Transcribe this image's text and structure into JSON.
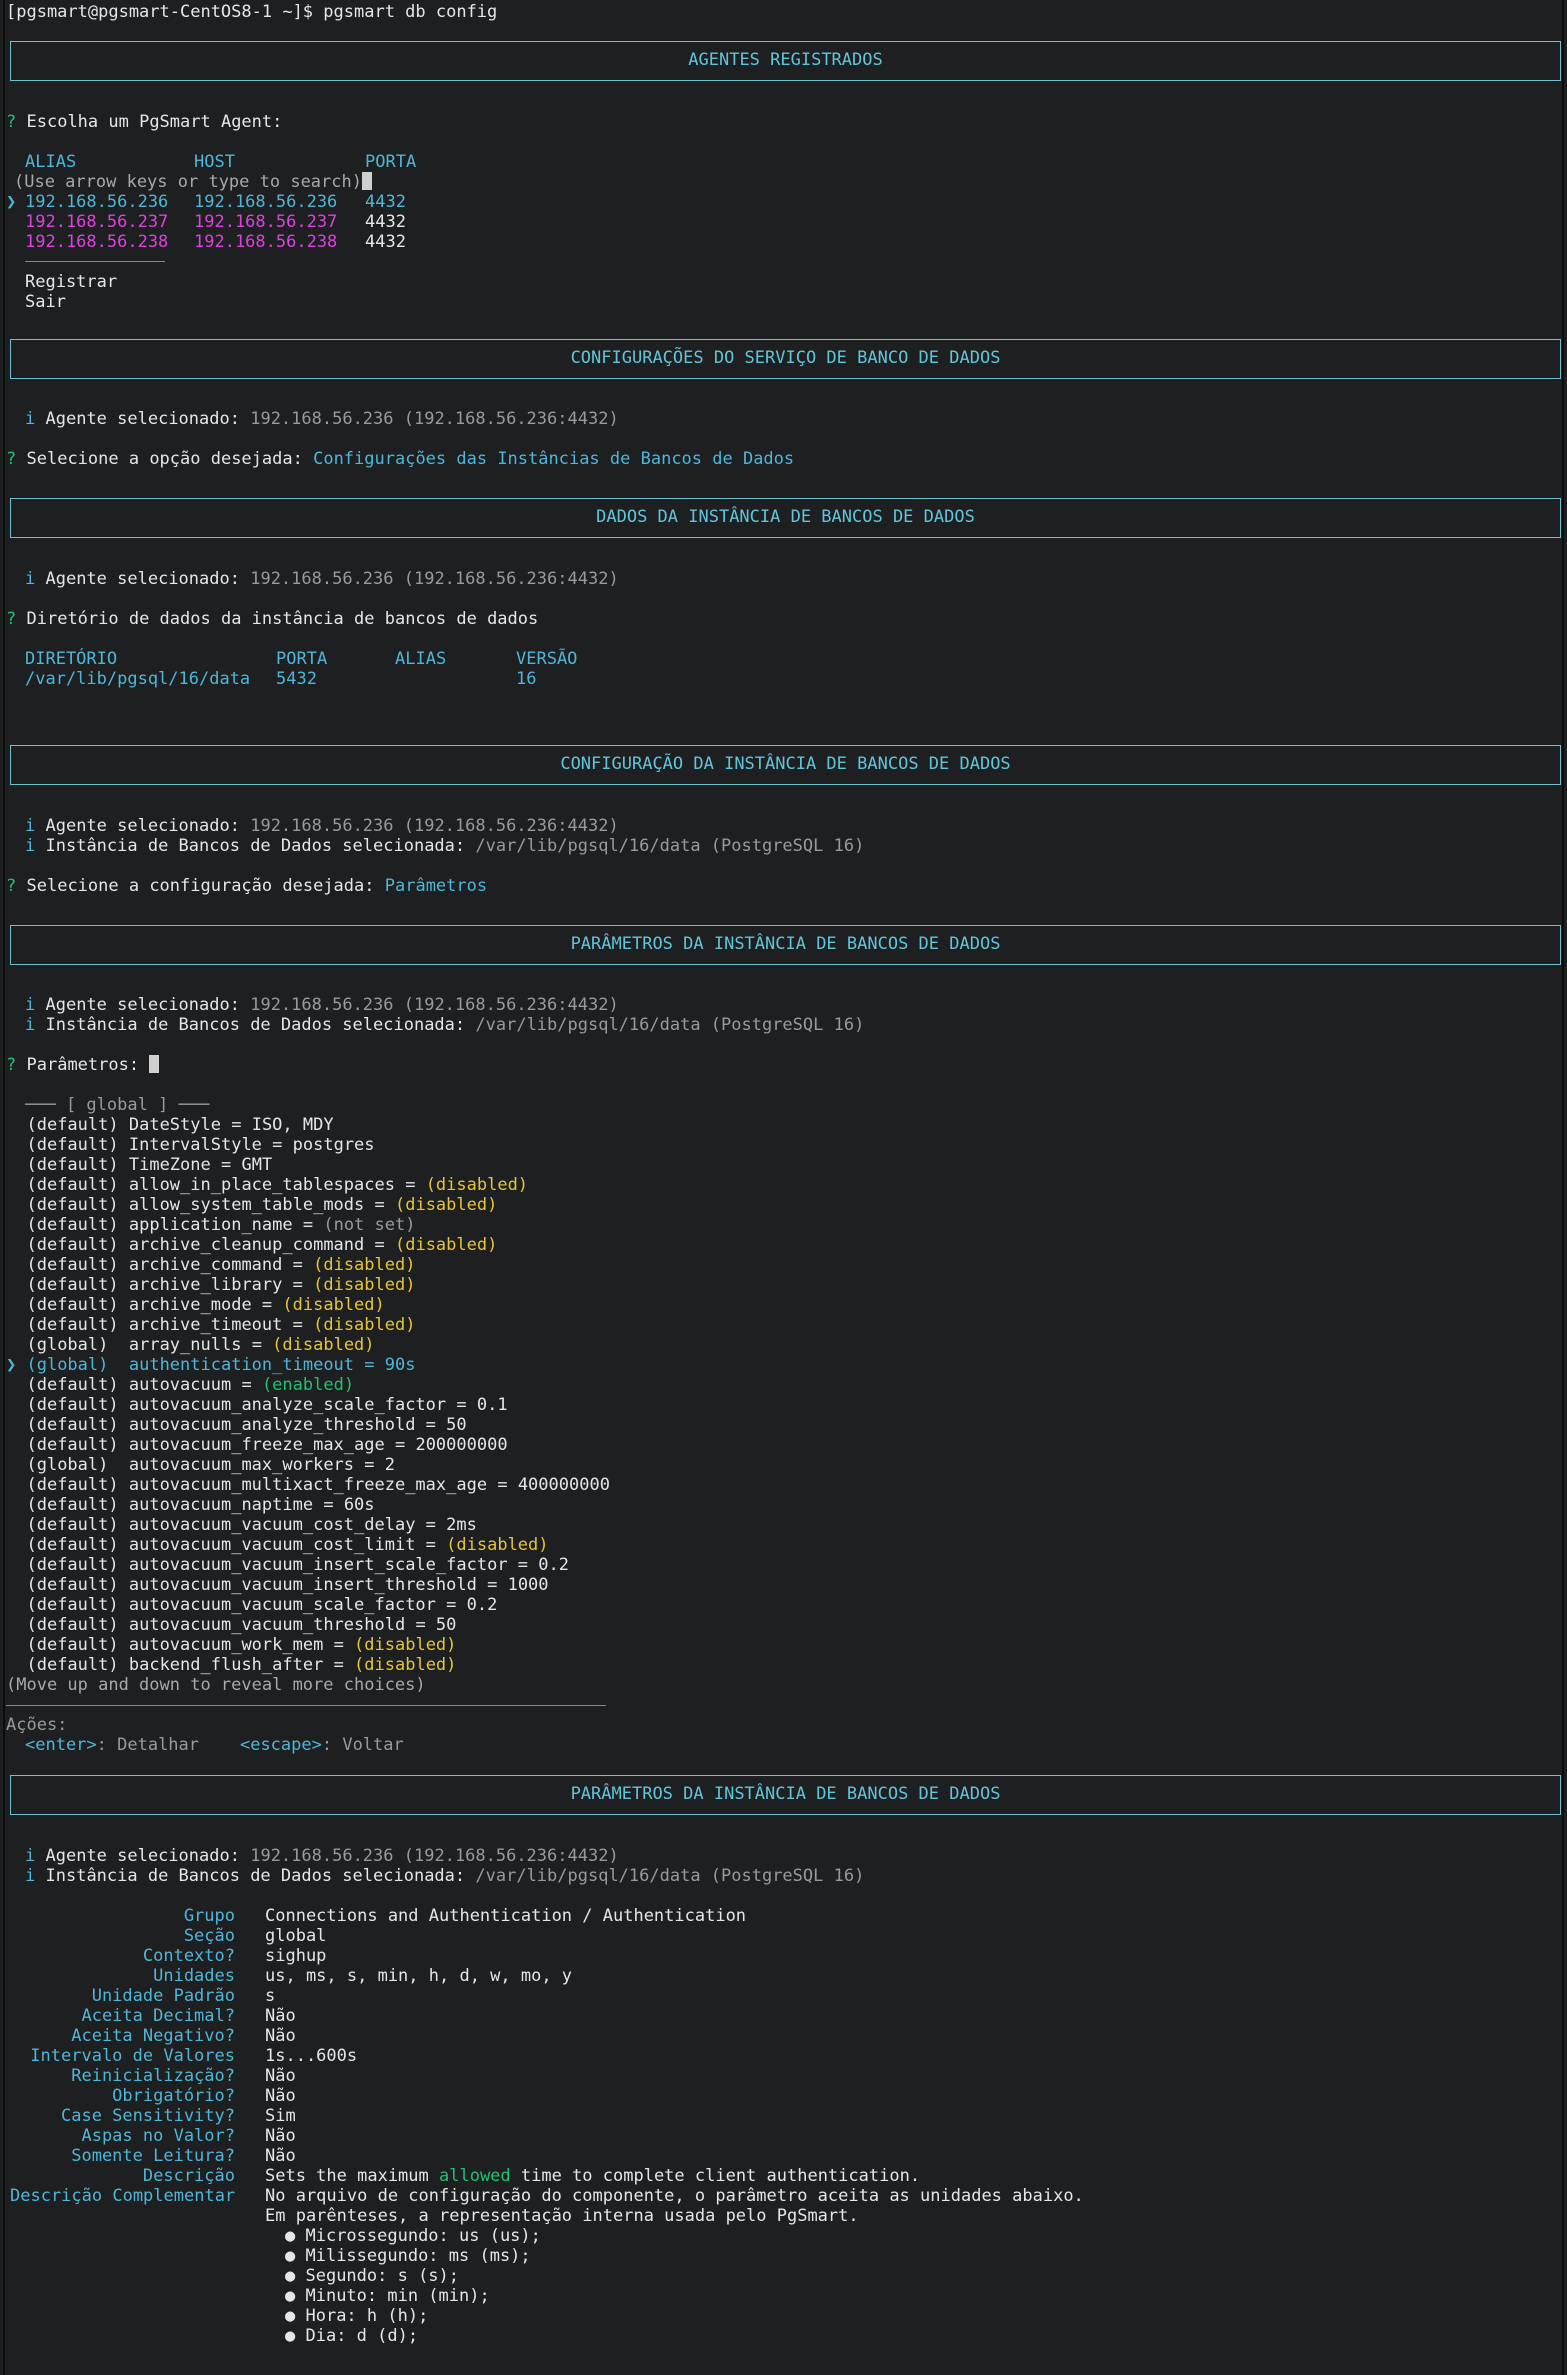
{
  "prompt_line": "[pgsmart@pgsmart-CentOS8-1 ~]$ pgsmart db config",
  "boxes": {
    "agents": "AGENTES REGISTRADOS",
    "service_config": "CONFIGURAÇÕES DO SERVIÇO DE BANCO DE DADOS",
    "instance_data": "DADOS DA INSTÂNCIA DE BANCOS DE DADOS",
    "instance_config": "CONFIGURAÇÃO DA INSTÂNCIA DE BANCOS DE DADOS",
    "params1": "PARÂMETROS DA INSTÂNCIA DE BANCOS DE DADOS",
    "params2": "PARÂMETROS DA INSTÂNCIA DE BANCOS DE DADOS"
  },
  "agents": {
    "question": "Escolha um PgSmart Agent:",
    "headers": {
      "alias": "ALIAS",
      "host": "HOST",
      "port": "PORTA"
    },
    "hint": "(Use arrow keys or type to search)",
    "rows": [
      {
        "alias": "192.168.56.236",
        "host": "192.168.56.236",
        "port": "4432"
      },
      {
        "alias": "192.168.56.237",
        "host": "192.168.56.237",
        "port": "4432"
      },
      {
        "alias": "192.168.56.238",
        "host": "192.168.56.238",
        "port": "4432"
      }
    ],
    "register": "Registrar",
    "exit": "Sair"
  },
  "info": {
    "agent_label": "Agente selecionado:",
    "agent_value": "192.168.56.236 (192.168.56.236:4432)",
    "instance_label": "Instância de Bancos de Dados selecionada:",
    "instance_value": "/var/lib/pgsql/16/data (PostgreSQL 16)"
  },
  "service": {
    "question": "Selecione a opção desejada:",
    "answer": "Configurações das Instâncias de Bancos de Dados"
  },
  "instance_data": {
    "question": "Diretório de dados da instância de bancos de dados",
    "headers": {
      "dir": "DIRETÓRIO",
      "port": "PORTA",
      "alias": "ALIAS",
      "version": "VERSÃO"
    },
    "row": {
      "dir": "/var/lib/pgsql/16/data",
      "port": "5432",
      "alias": "",
      "version": "16"
    }
  },
  "instance_config": {
    "question": "Selecione a configuração desejada:",
    "answer": "Parâmetros"
  },
  "params": {
    "question": "Parâmetros:",
    "group_header": "─── [ global ] ───",
    "items": [
      {
        "scope": "(default)",
        "name": "DateStyle",
        "value": "ISO, MDY",
        "kind": "plain"
      },
      {
        "scope": "(default)",
        "name": "IntervalStyle",
        "value": "postgres",
        "kind": "plain"
      },
      {
        "scope": "(default)",
        "name": "TimeZone",
        "value": "GMT",
        "kind": "plain"
      },
      {
        "scope": "(default)",
        "name": "allow_in_place_tablespaces",
        "value": "(disabled)",
        "kind": "disabled"
      },
      {
        "scope": "(default)",
        "name": "allow_system_table_mods",
        "value": "(disabled)",
        "kind": "disabled"
      },
      {
        "scope": "(default)",
        "name": "application_name",
        "value": "(not set)",
        "kind": "notset"
      },
      {
        "scope": "(default)",
        "name": "archive_cleanup_command",
        "value": "(disabled)",
        "kind": "disabled"
      },
      {
        "scope": "(default)",
        "name": "archive_command",
        "value": "(disabled)",
        "kind": "disabled"
      },
      {
        "scope": "(default)",
        "name": "archive_library",
        "value": "(disabled)",
        "kind": "disabled"
      },
      {
        "scope": "(default)",
        "name": "archive_mode",
        "value": "(disabled)",
        "kind": "disabled"
      },
      {
        "scope": "(default)",
        "name": "archive_timeout",
        "value": "(disabled)",
        "kind": "disabled"
      },
      {
        "scope": "(global) ",
        "name": "array_nulls",
        "value": "(disabled)",
        "kind": "disabled"
      },
      {
        "scope": "(global) ",
        "name": "authentication_timeout",
        "value": "90s",
        "kind": "selected"
      },
      {
        "scope": "(default)",
        "name": "autovacuum",
        "value": "(enabled)",
        "kind": "enabled"
      },
      {
        "scope": "(default)",
        "name": "autovacuum_analyze_scale_factor",
        "value": "0.1",
        "kind": "plain"
      },
      {
        "scope": "(default)",
        "name": "autovacuum_analyze_threshold",
        "value": "50",
        "kind": "plain"
      },
      {
        "scope": "(default)",
        "name": "autovacuum_freeze_max_age",
        "value": "200000000",
        "kind": "plain"
      },
      {
        "scope": "(global) ",
        "name": "autovacuum_max_workers",
        "value": "2",
        "kind": "plain"
      },
      {
        "scope": "(default)",
        "name": "autovacuum_multixact_freeze_max_age",
        "value": "400000000",
        "kind": "plain"
      },
      {
        "scope": "(default)",
        "name": "autovacuum_naptime",
        "value": "60s",
        "kind": "plain"
      },
      {
        "scope": "(default)",
        "name": "autovacuum_vacuum_cost_delay",
        "value": "2ms",
        "kind": "plain"
      },
      {
        "scope": "(default)",
        "name": "autovacuum_vacuum_cost_limit",
        "value": "(disabled)",
        "kind": "disabled"
      },
      {
        "scope": "(default)",
        "name": "autovacuum_vacuum_insert_scale_factor",
        "value": "0.2",
        "kind": "plain"
      },
      {
        "scope": "(default)",
        "name": "autovacuum_vacuum_insert_threshold",
        "value": "1000",
        "kind": "plain"
      },
      {
        "scope": "(default)",
        "name": "autovacuum_vacuum_scale_factor",
        "value": "0.2",
        "kind": "plain"
      },
      {
        "scope": "(default)",
        "name": "autovacuum_vacuum_threshold",
        "value": "50",
        "kind": "plain"
      },
      {
        "scope": "(default)",
        "name": "autovacuum_work_mem",
        "value": "(disabled)",
        "kind": "disabled"
      },
      {
        "scope": "(default)",
        "name": "backend_flush_after",
        "value": "(disabled)",
        "kind": "disabled"
      }
    ],
    "more_hint": "(Move up and down to reveal more choices)",
    "actions_label": "Ações:",
    "enter_key": "<enter>",
    "enter_action": ": Detalhar",
    "escape_key": "<escape>",
    "escape_action": ": Voltar"
  },
  "detail": {
    "fields": [
      {
        "label": "Grupo",
        "value": "Connections and Authentication / Authentication"
      },
      {
        "label": "Seção",
        "value": "global"
      },
      {
        "label": "Contexto?",
        "value": "sighup"
      },
      {
        "label": "Unidades",
        "value": "us, ms, s, min, h, d, w, mo, y"
      },
      {
        "label": "Unidade Padrão",
        "value": "s"
      },
      {
        "label": "Aceita Decimal?",
        "value": "Não"
      },
      {
        "label": "Aceita Negativo?",
        "value": "Não"
      },
      {
        "label": "Intervalo de Valores",
        "value": "1s...600s"
      },
      {
        "label": "Reinicialização?",
        "value": "Não"
      },
      {
        "label": "Obrigatório?",
        "value": "Não"
      },
      {
        "label": "Case Sensitivity?",
        "value": "Sim"
      },
      {
        "label": "Aspas no Valor?",
        "value": "Não"
      },
      {
        "label": "Somente Leitura?",
        "value": "Não"
      }
    ],
    "desc_label": "Descrição",
    "desc_pre": "Sets the maximum ",
    "desc_hl": "allowed",
    "desc_post": " time to complete client authentication.",
    "comp_label": "Descrição Complementar",
    "comp_lines": [
      "No arquivo de configuração do componente, o parâmetro aceita as unidades abaixo.",
      "Em parênteses, a representação interna usada pelo PgSmart."
    ],
    "bullets": [
      "Microssegundo: us (us);",
      "Milissegundo: ms (ms);",
      "Segundo: s (s);",
      "Minuto: min (min);",
      "Hora: h (h);",
      "Dia: d (d);"
    ]
  }
}
